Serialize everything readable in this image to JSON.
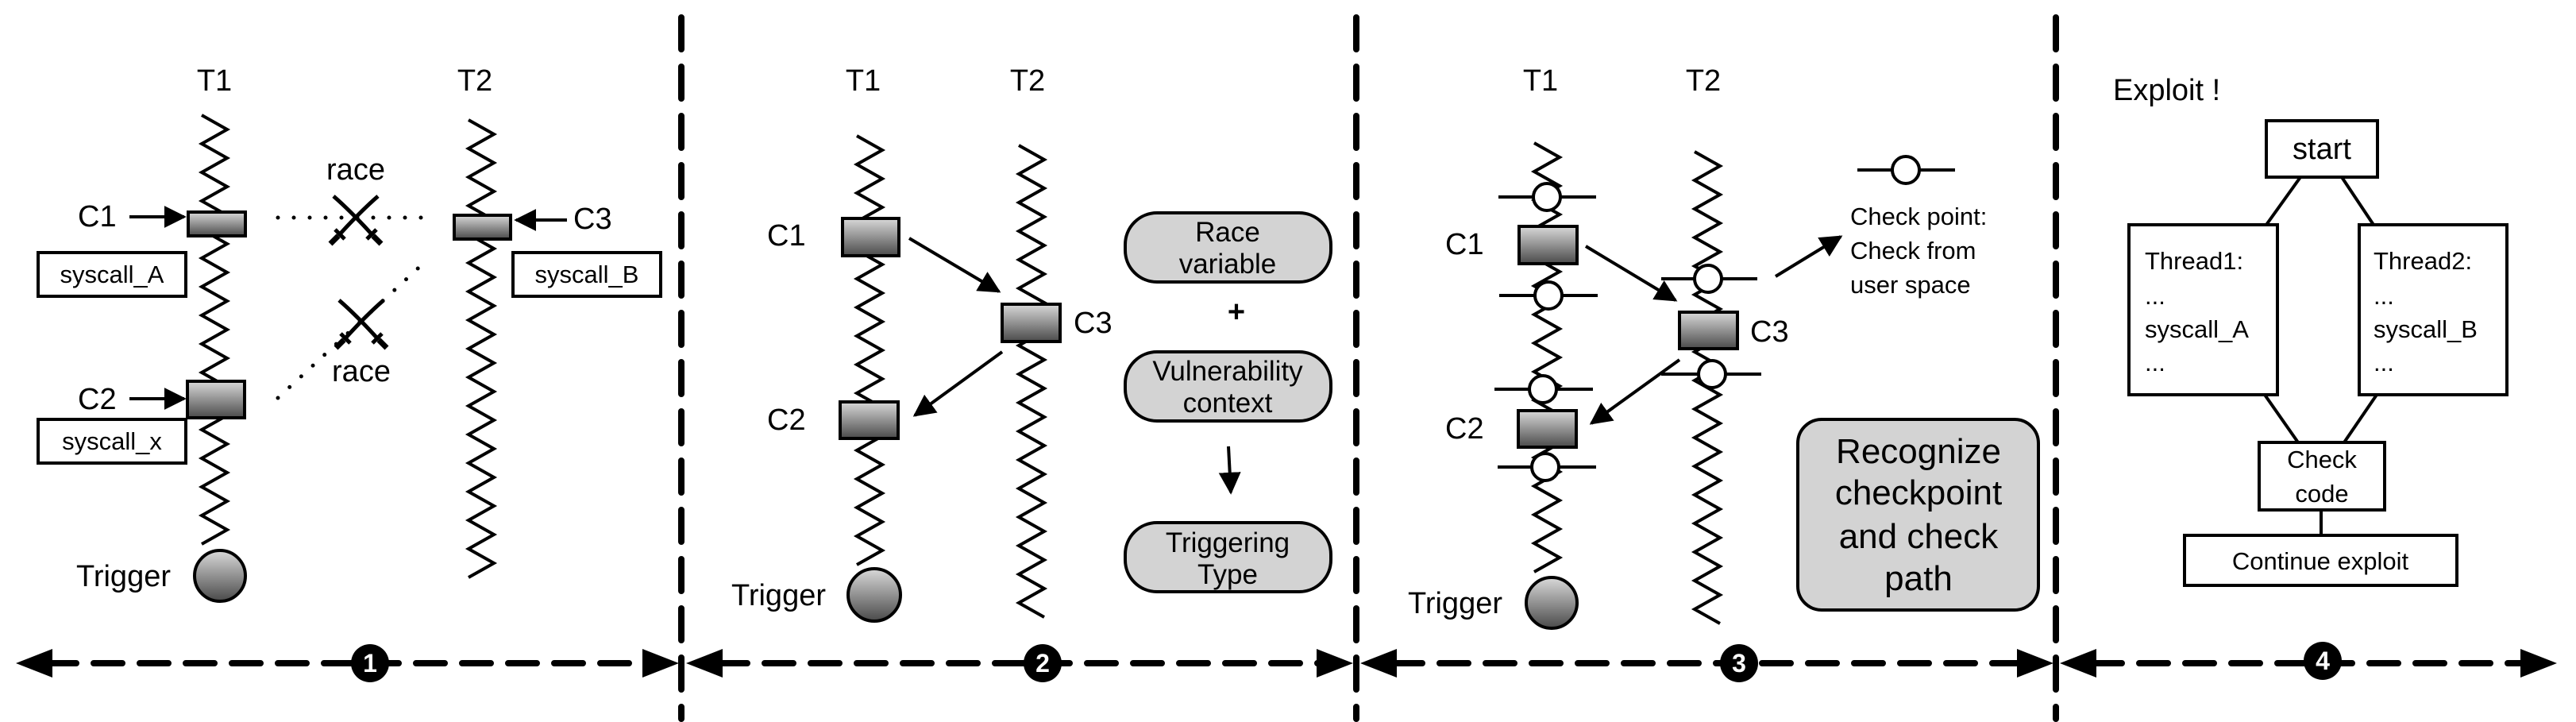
{
  "colors": {
    "stroke": "#000000",
    "box_gradient_top": "#d9d9d9",
    "box_gradient_bottom": "#4a4a4a",
    "pill_fill": "#d3d3d3",
    "background": "#ffffff"
  },
  "icons": {
    "race": "crossed-swords-icon",
    "checkpoint": "checkpoint-circle-icon",
    "trigger": "trigger-circle-icon"
  },
  "panel1": {
    "t1": "T1",
    "t2": "T2",
    "c1": "C1",
    "c2": "C2",
    "c3": "C3",
    "syscall_a": "syscall_A",
    "syscall_x": "syscall_x",
    "syscall_b": "syscall_B",
    "race_top": "race",
    "race_bottom": "race",
    "trigger": "Trigger",
    "step": "1"
  },
  "panel2": {
    "t1": "T1",
    "t2": "T2",
    "c1": "C1",
    "c2": "C2",
    "c3": "C3",
    "trigger": "Trigger",
    "race_variable": [
      "Race",
      "variable"
    ],
    "plus": "+",
    "vulnerability_context": [
      "Vulnerability",
      "context"
    ],
    "triggering_type": [
      "Triggering",
      "Type"
    ],
    "step": "2"
  },
  "panel3": {
    "t1": "T1",
    "t2": "T2",
    "c1": "C1",
    "c2": "C2",
    "c3": "C3",
    "trigger": "Trigger",
    "checkpoint_legend": [
      "Check point:",
      "Check from",
      "user space"
    ],
    "recognize": [
      "Recognize",
      "checkpoint",
      "and check",
      "path"
    ],
    "step": "3"
  },
  "panel4": {
    "title": "Exploit !",
    "start": "start",
    "thread1": [
      "Thread1:",
      "...",
      "syscall_A",
      "..."
    ],
    "thread2": [
      "Thread2:",
      "...",
      "syscall_B",
      "..."
    ],
    "check_code": [
      "Check",
      "code"
    ],
    "continue": "Continue exploit",
    "step": "4"
  }
}
